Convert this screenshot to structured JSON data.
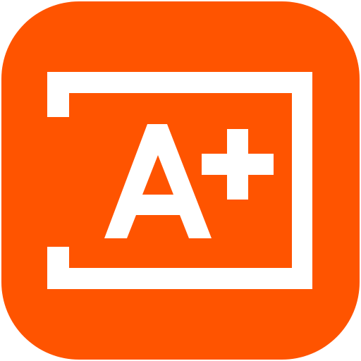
{
  "app_icon": {
    "name": "A+",
    "colors": {
      "background": "#FF5400",
      "foreground": "#FFFFFF"
    },
    "logo": {
      "glyph": "A",
      "symbol": "+",
      "frame": "bracket-frame"
    }
  }
}
